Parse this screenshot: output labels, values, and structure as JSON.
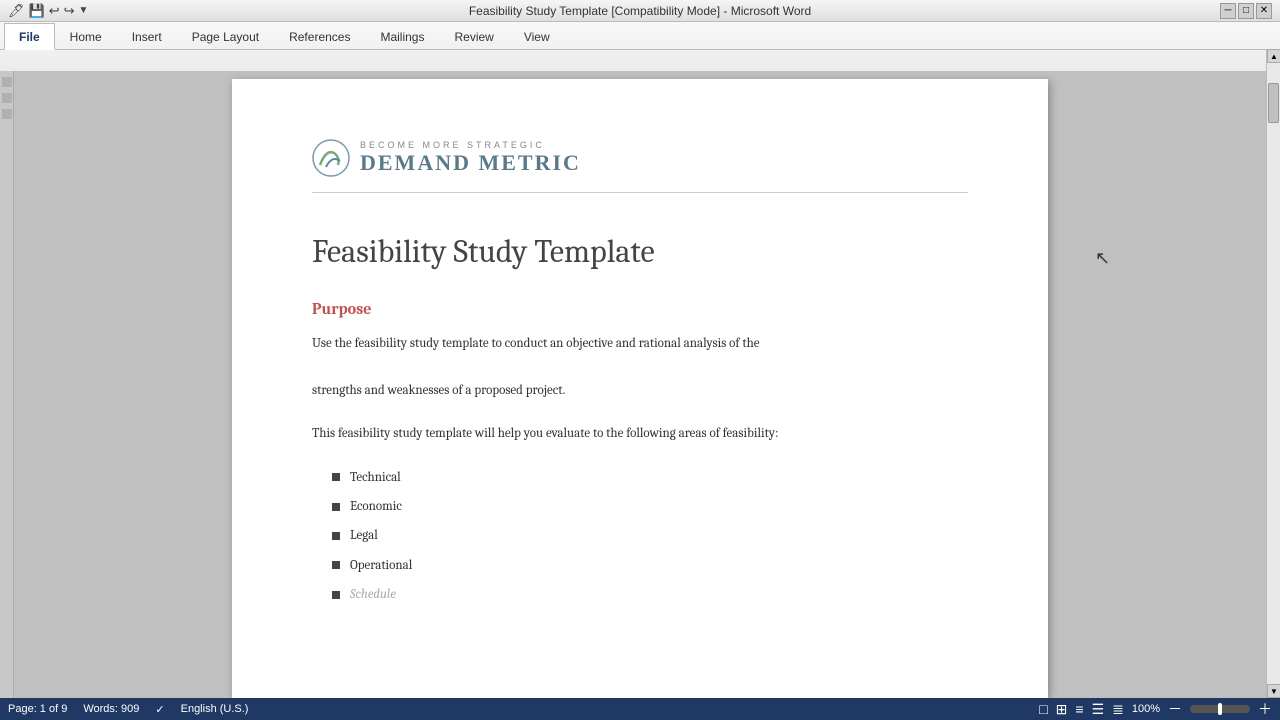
{
  "window": {
    "title": "Feasibility Study Template [Compatibility Mode] - Microsoft Word",
    "titlebar_buttons": [
      "minimize",
      "maximize",
      "close"
    ]
  },
  "quickaccess": {
    "icons": [
      "save",
      "undo",
      "redo",
      "customize"
    ]
  },
  "ribbon": {
    "tabs": [
      {
        "label": "File",
        "active": true
      },
      {
        "label": "Home",
        "active": false
      },
      {
        "label": "Insert",
        "active": false
      },
      {
        "label": "Page Layout",
        "active": false
      },
      {
        "label": "References",
        "active": false
      },
      {
        "label": "Mailings",
        "active": false
      },
      {
        "label": "Review",
        "active": false
      },
      {
        "label": "View",
        "active": false
      }
    ]
  },
  "document": {
    "logo": {
      "tagline": "Become More Strategic",
      "name": "Demand Metric"
    },
    "title": "Feasibility Study Template",
    "purpose_heading": "Purpose",
    "paragraph1": "Use the feasibility study template to conduct an objective and rational analysis of the\n\nstrengths and weaknesses of a proposed project.",
    "paragraph2": "This feasibility study template will help you evaluate to the following areas of feasibility:",
    "bullet_items": [
      {
        "text": "Technical"
      },
      {
        "text": "Economic"
      },
      {
        "text": "Legal"
      },
      {
        "text": "Operational"
      },
      {
        "text": "Schedule"
      }
    ]
  },
  "statusbar": {
    "page_info": "Page: 1 of 9",
    "words": "Words: 909",
    "language": "English (U.S.)",
    "zoom": "100%"
  }
}
